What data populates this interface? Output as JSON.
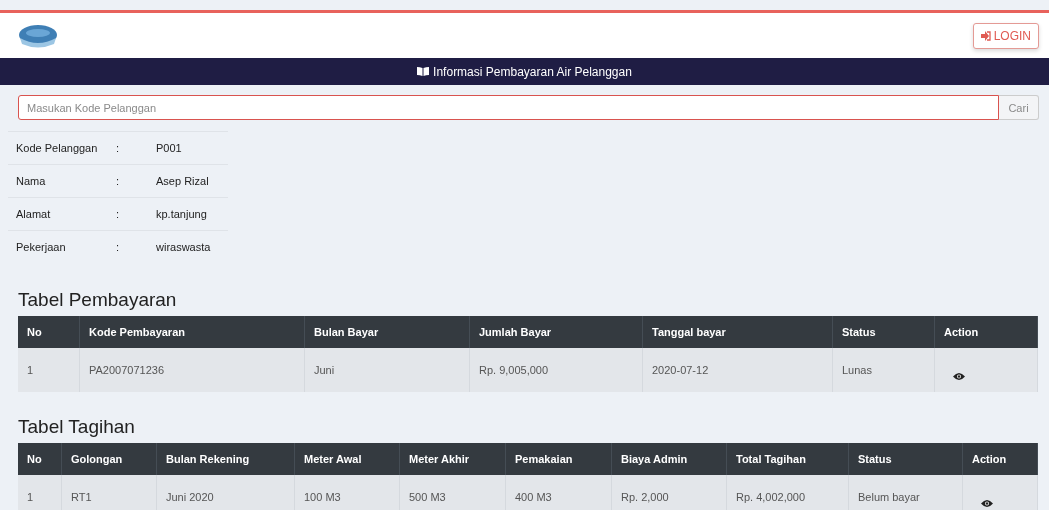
{
  "header": {
    "login_button": "LOGIN"
  },
  "banner": {
    "title": "Informasi Pembayaran Air Pelanggan"
  },
  "search": {
    "placeholder": "Masukan Kode Pelanggan",
    "button": "Cari"
  },
  "customer": [
    {
      "label": "Kode Pelanggan",
      "separator": ":",
      "value": "P001"
    },
    {
      "label": "Nama",
      "separator": ":",
      "value": "Asep Rizal"
    },
    {
      "label": "Alamat",
      "separator": ":",
      "value": "kp.tanjung"
    },
    {
      "label": "Pekerjaan",
      "separator": ":",
      "value": "wiraswasta"
    }
  ],
  "tables": [
    {
      "title": "Tabel Pembayaran",
      "columns": [
        "No",
        "Kode Pembayaran",
        "Bulan Bayar",
        "Jumlah Bayar",
        "Tanggal bayar",
        "Status",
        "Action"
      ],
      "rows": [
        {
          "cells": [
            "1",
            "PA2007071236",
            "Juni",
            "Rp. 9,005,000",
            "2020-07-12",
            "Lunas"
          ]
        }
      ]
    },
    {
      "title": "Tabel Tagihan",
      "columns": [
        "No",
        "Golongan",
        "Bulan Rekening",
        "Meter Awal",
        "Meter Akhir",
        "Pemakaian",
        "Biaya Admin",
        "Total Tagihan",
        "Status",
        "Action"
      ],
      "rows": [
        {
          "cells": [
            "1",
            "RT1",
            "Juni 2020",
            "100 M3",
            "500 M3",
            "400 M3",
            "Rp. 2,000",
            "Rp. 4,002,000",
            "Belum bayar"
          ]
        }
      ]
    }
  ]
}
